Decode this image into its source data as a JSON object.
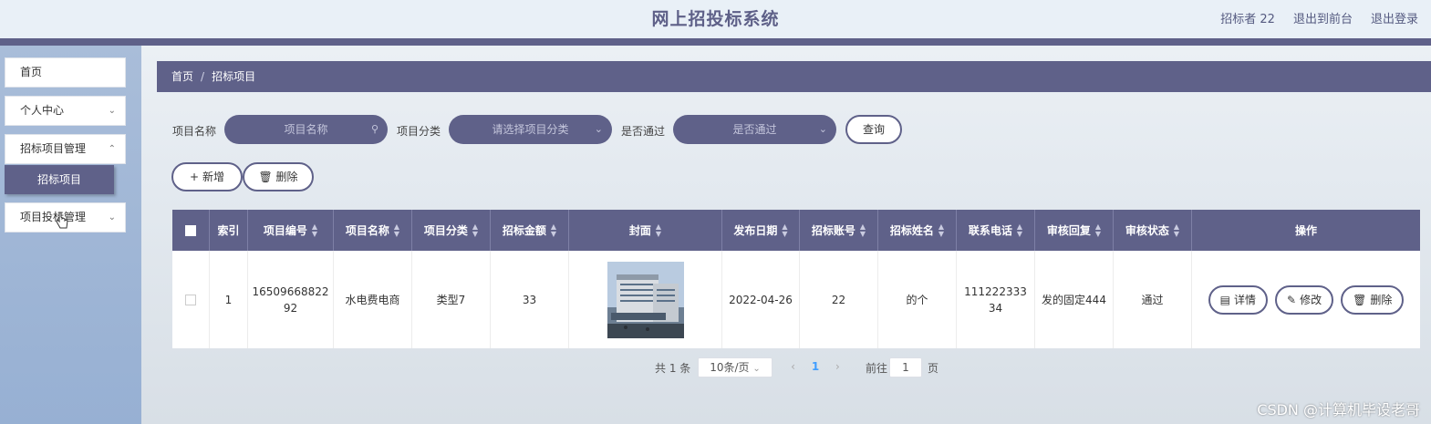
{
  "header": {
    "title": "网上招投标系统",
    "user": "招标者 22",
    "to_front": "退出到前台",
    "logout": "退出登录"
  },
  "sidebar": {
    "items": [
      {
        "label": "首页"
      },
      {
        "label": "个人中心"
      },
      {
        "label": "招标项目管理"
      },
      {
        "label": "项目投标管理"
      }
    ],
    "active_sub": "招标项目"
  },
  "breadcrumb": {
    "home": "首页",
    "sep": "/",
    "current": "招标项目"
  },
  "search": {
    "name_label": "项目名称",
    "name_placeholder": "项目名称",
    "category_label": "项目分类",
    "category_placeholder": "请选择项目分类",
    "pass_label": "是否通过",
    "pass_placeholder": "是否通过",
    "query_button": "查询"
  },
  "toolbar": {
    "add": "新增",
    "delete": "删除"
  },
  "table": {
    "columns": [
      "索引",
      "项目编号",
      "项目名称",
      "项目分类",
      "招标金额",
      "封面",
      "发布日期",
      "招标账号",
      "招标姓名",
      "联系电话",
      "审核回复",
      "审核状态",
      "操作"
    ],
    "rows": [
      {
        "index": "1",
        "project_no_1": "16509668822",
        "project_no_2": "92",
        "name": "水电费电商",
        "category": "类型7",
        "amount": "33",
        "date": "2022-04-26",
        "account": "22",
        "contact_name": "的个",
        "phone_1": "111222333",
        "phone_2": "34",
        "reply": "发的固定444",
        "status": "通过"
      }
    ],
    "row_actions": {
      "detail": "详情",
      "edit": "修改",
      "delete": "删除"
    }
  },
  "pagination": {
    "total": "共 1 条",
    "page_size": "10条/页",
    "current_page": "1",
    "goto_label": "前往",
    "goto_value": "1",
    "page_unit": "页"
  },
  "watermark": "CSDN @计算机毕设老哥"
}
